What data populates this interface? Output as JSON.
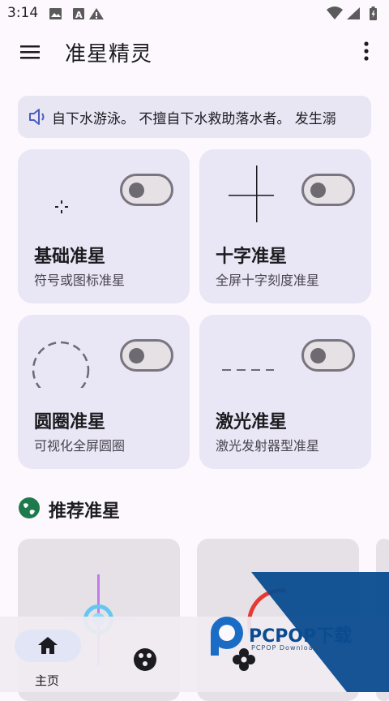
{
  "status_bar": {
    "time": "3:14",
    "left_icons": [
      "image-icon",
      "a-icon",
      "warning-icon"
    ],
    "right_icons": [
      "wifi-icon",
      "signal-icon",
      "battery-icon"
    ]
  },
  "app_bar": {
    "title": "准星精灵",
    "menu_icon": "menu-icon",
    "more_icon": "more-vert-icon"
  },
  "notice": {
    "icon": "speaker-icon",
    "text": "自下水游泳。 不擅自下水救助落水者。 发生溺"
  },
  "cards": [
    {
      "title": "基础准星",
      "subtitle": "符号或图标准星",
      "enabled": false,
      "preview": "small-dot-cross"
    },
    {
      "title": "十字准星",
      "subtitle": "全屏十字刻度准星",
      "enabled": false,
      "preview": "large-cross"
    },
    {
      "title": "圆圈准星",
      "subtitle": "可视化全屏圆圈",
      "enabled": false,
      "preview": "dashed-circle"
    },
    {
      "title": "激光准星",
      "subtitle": "激光发射器型准星",
      "enabled": false,
      "preview": "dashed-line"
    }
  ],
  "section": {
    "title": "推荐准星",
    "icon": "globe-icon"
  },
  "bottom_nav": {
    "items": [
      {
        "label": "主页",
        "icon": "home-icon",
        "selected": true
      },
      {
        "label": "",
        "icon": "palette-icon",
        "selected": false
      },
      {
        "label": "",
        "icon": "flower-icon",
        "selected": false
      }
    ]
  },
  "watermark": {
    "text": "PCPOP下载",
    "sub": "PCPOP Download"
  },
  "colors": {
    "background": "#fcf8fd",
    "card": "#e9e6f5",
    "accent": "#4a5dbb",
    "section_icon": "#1e7a4c",
    "watermark_blue": "#0a4c8f"
  }
}
